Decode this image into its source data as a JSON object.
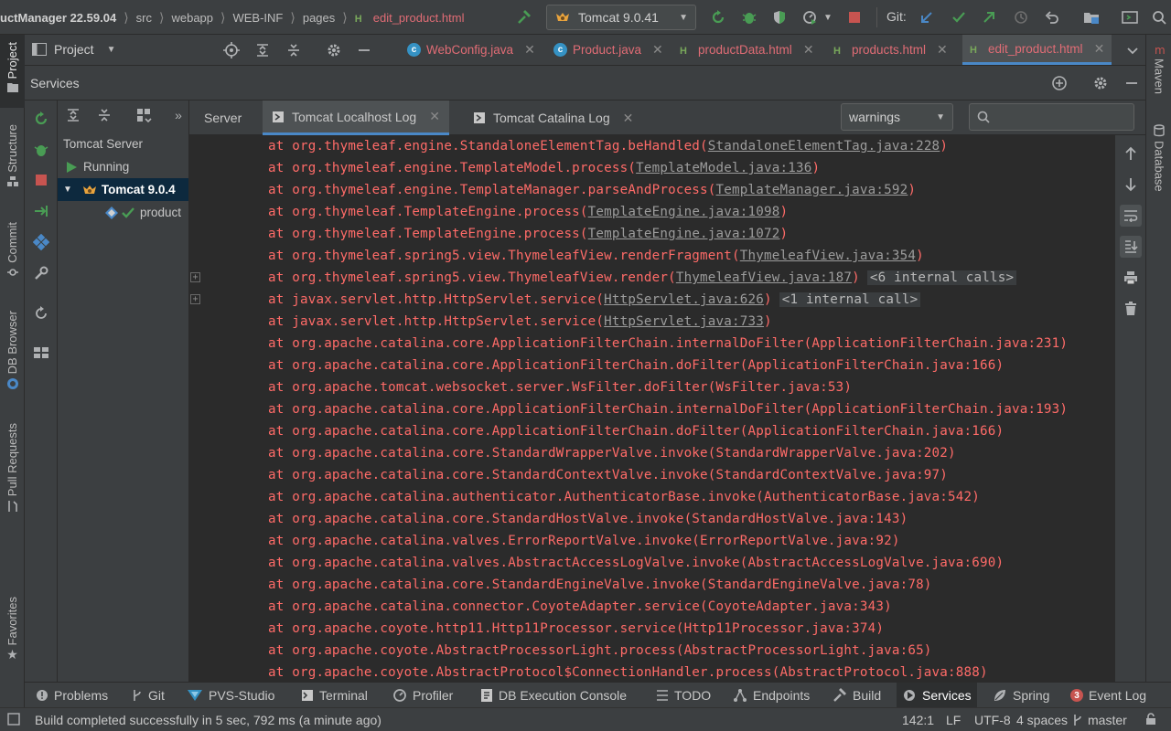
{
  "navbar": {
    "breadcrumbs": [
      "uctManager 22.59.04",
      "src",
      "webapp",
      "WEB-INF",
      "pages"
    ],
    "current_file": "edit_product.html",
    "run_config": "Tomcat 9.0.41",
    "git_label": "Git:"
  },
  "project_panel": {
    "title": "Project"
  },
  "editor_tabs": [
    {
      "label": "WebConfig.java",
      "icon": "java-class-icon"
    },
    {
      "label": "Product.java",
      "icon": "java-class-icon"
    },
    {
      "label": "productData.html",
      "icon": "html-file-icon"
    },
    {
      "label": "products.html",
      "icon": "html-file-icon"
    },
    {
      "label": "edit_product.html",
      "icon": "html-file-icon",
      "active": true
    }
  ],
  "left_stripe": [
    "Project",
    "Structure",
    "Commit",
    "DB Browser",
    "Pull Requests",
    "Favorites"
  ],
  "right_stripe": [
    "Maven",
    "Database"
  ],
  "services": {
    "title": "Services",
    "tree": {
      "root": "Tomcat Server",
      "status": "Running",
      "server": "Tomcat 9.0.4",
      "artifact": "product"
    },
    "log_tabs": [
      "Server",
      "Tomcat Localhost Log",
      "Tomcat Catalina Log"
    ],
    "active_log_tab": 1,
    "filter_value": "warnings",
    "search_placeholder": ""
  },
  "log_lines": [
    {
      "prefix": "at org.thymeleaf.engine.StandaloneElementTag.beHandled(",
      "link": "StandaloneElementTag.java:228",
      "suffix": ")"
    },
    {
      "prefix": "at org.thymeleaf.engine.TemplateModel.process(",
      "link": "TemplateModel.java:136",
      "suffix": ")"
    },
    {
      "prefix": "at org.thymeleaf.engine.TemplateManager.parseAndProcess(",
      "link": "TemplateManager.java:592",
      "suffix": ")"
    },
    {
      "prefix": "at org.thymeleaf.TemplateEngine.process(",
      "link": "TemplateEngine.java:1098",
      "suffix": ")"
    },
    {
      "prefix": "at org.thymeleaf.TemplateEngine.process(",
      "link": "TemplateEngine.java:1072",
      "suffix": ")"
    },
    {
      "prefix": "at org.thymeleaf.spring5.view.ThymeleafView.renderFragment(",
      "link": "ThymeleafView.java:354",
      "suffix": ")"
    },
    {
      "prefix": "at org.thymeleaf.spring5.view.ThymeleafView.render(",
      "link": "ThymeleafView.java:187",
      "suffix": ")",
      "internal": "<6 internal calls>",
      "fold": true
    },
    {
      "prefix": "at javax.servlet.http.HttpServlet.service(",
      "link": "HttpServlet.java:626",
      "suffix": ")",
      "internal": "<1 internal call>",
      "fold": true
    },
    {
      "prefix": "at javax.servlet.http.HttpServlet.service(",
      "link": "HttpServlet.java:733",
      "suffix": ")"
    },
    {
      "prefix": "at org.apache.catalina.core.ApplicationFilterChain.internalDoFilter(ApplicationFilterChain.java:231)"
    },
    {
      "prefix": "at org.apache.catalina.core.ApplicationFilterChain.doFilter(ApplicationFilterChain.java:166)"
    },
    {
      "prefix": "at org.apache.tomcat.websocket.server.WsFilter.doFilter(WsFilter.java:53)"
    },
    {
      "prefix": "at org.apache.catalina.core.ApplicationFilterChain.internalDoFilter(ApplicationFilterChain.java:193)"
    },
    {
      "prefix": "at org.apache.catalina.core.ApplicationFilterChain.doFilter(ApplicationFilterChain.java:166)"
    },
    {
      "prefix": "at org.apache.catalina.core.StandardWrapperValve.invoke(StandardWrapperValve.java:202)"
    },
    {
      "prefix": "at org.apache.catalina.core.StandardContextValve.invoke(StandardContextValve.java:97)"
    },
    {
      "prefix": "at org.apache.catalina.authenticator.AuthenticatorBase.invoke(AuthenticatorBase.java:542)"
    },
    {
      "prefix": "at org.apache.catalina.core.StandardHostValve.invoke(StandardHostValve.java:143)"
    },
    {
      "prefix": "at org.apache.catalina.valves.ErrorReportValve.invoke(ErrorReportValve.java:92)"
    },
    {
      "prefix": "at org.apache.catalina.valves.AbstractAccessLogValve.invoke(AbstractAccessLogValve.java:690)"
    },
    {
      "prefix": "at org.apache.catalina.core.StandardEngineValve.invoke(StandardEngineValve.java:78)"
    },
    {
      "prefix": "at org.apache.catalina.connector.CoyoteAdapter.service(CoyoteAdapter.java:343)"
    },
    {
      "prefix": "at org.apache.coyote.http11.Http11Processor.service(Http11Processor.java:374)"
    },
    {
      "prefix": "at org.apache.coyote.AbstractProcessorLight.process(AbstractProcessorLight.java:65)"
    },
    {
      "prefix": "at org.apache.coyote.AbstractProtocol$ConnectionHandler.process(AbstractProtocol.java:888)"
    }
  ],
  "bottom_tabs": [
    {
      "label": "Problems",
      "icon": "problems-icon"
    },
    {
      "label": "Git",
      "icon": "git-branch-icon"
    },
    {
      "label": "PVS-Studio",
      "icon": "pvs-studio-icon"
    },
    {
      "label": "Terminal",
      "icon": "terminal-icon"
    },
    {
      "label": "Profiler",
      "icon": "profiler-icon"
    },
    {
      "label": "DB Execution Console",
      "icon": "db-console-icon"
    },
    {
      "label": "TODO",
      "icon": "todo-icon"
    },
    {
      "label": "Endpoints",
      "icon": "endpoints-icon"
    },
    {
      "label": "Build",
      "icon": "build-hammer-icon"
    },
    {
      "label": "Services",
      "icon": "services-icon",
      "active": true
    },
    {
      "label": "Spring",
      "icon": "spring-leaf-icon"
    },
    {
      "label": "Event Log",
      "icon": "event-log-icon",
      "badge": "3"
    }
  ],
  "status_bar": {
    "message": "Build completed successfully in 5 sec, 792 ms (a minute ago)",
    "position": "142:1",
    "line_separator": "LF",
    "encoding": "UTF-8",
    "indent": "4 spaces",
    "branch": "master"
  },
  "colors": {
    "error_text": "#ff6b68",
    "link_text": "#9c9c9c",
    "accent": "#4a88c7",
    "run_green": "#499c54",
    "stop_red": "#c75450"
  }
}
